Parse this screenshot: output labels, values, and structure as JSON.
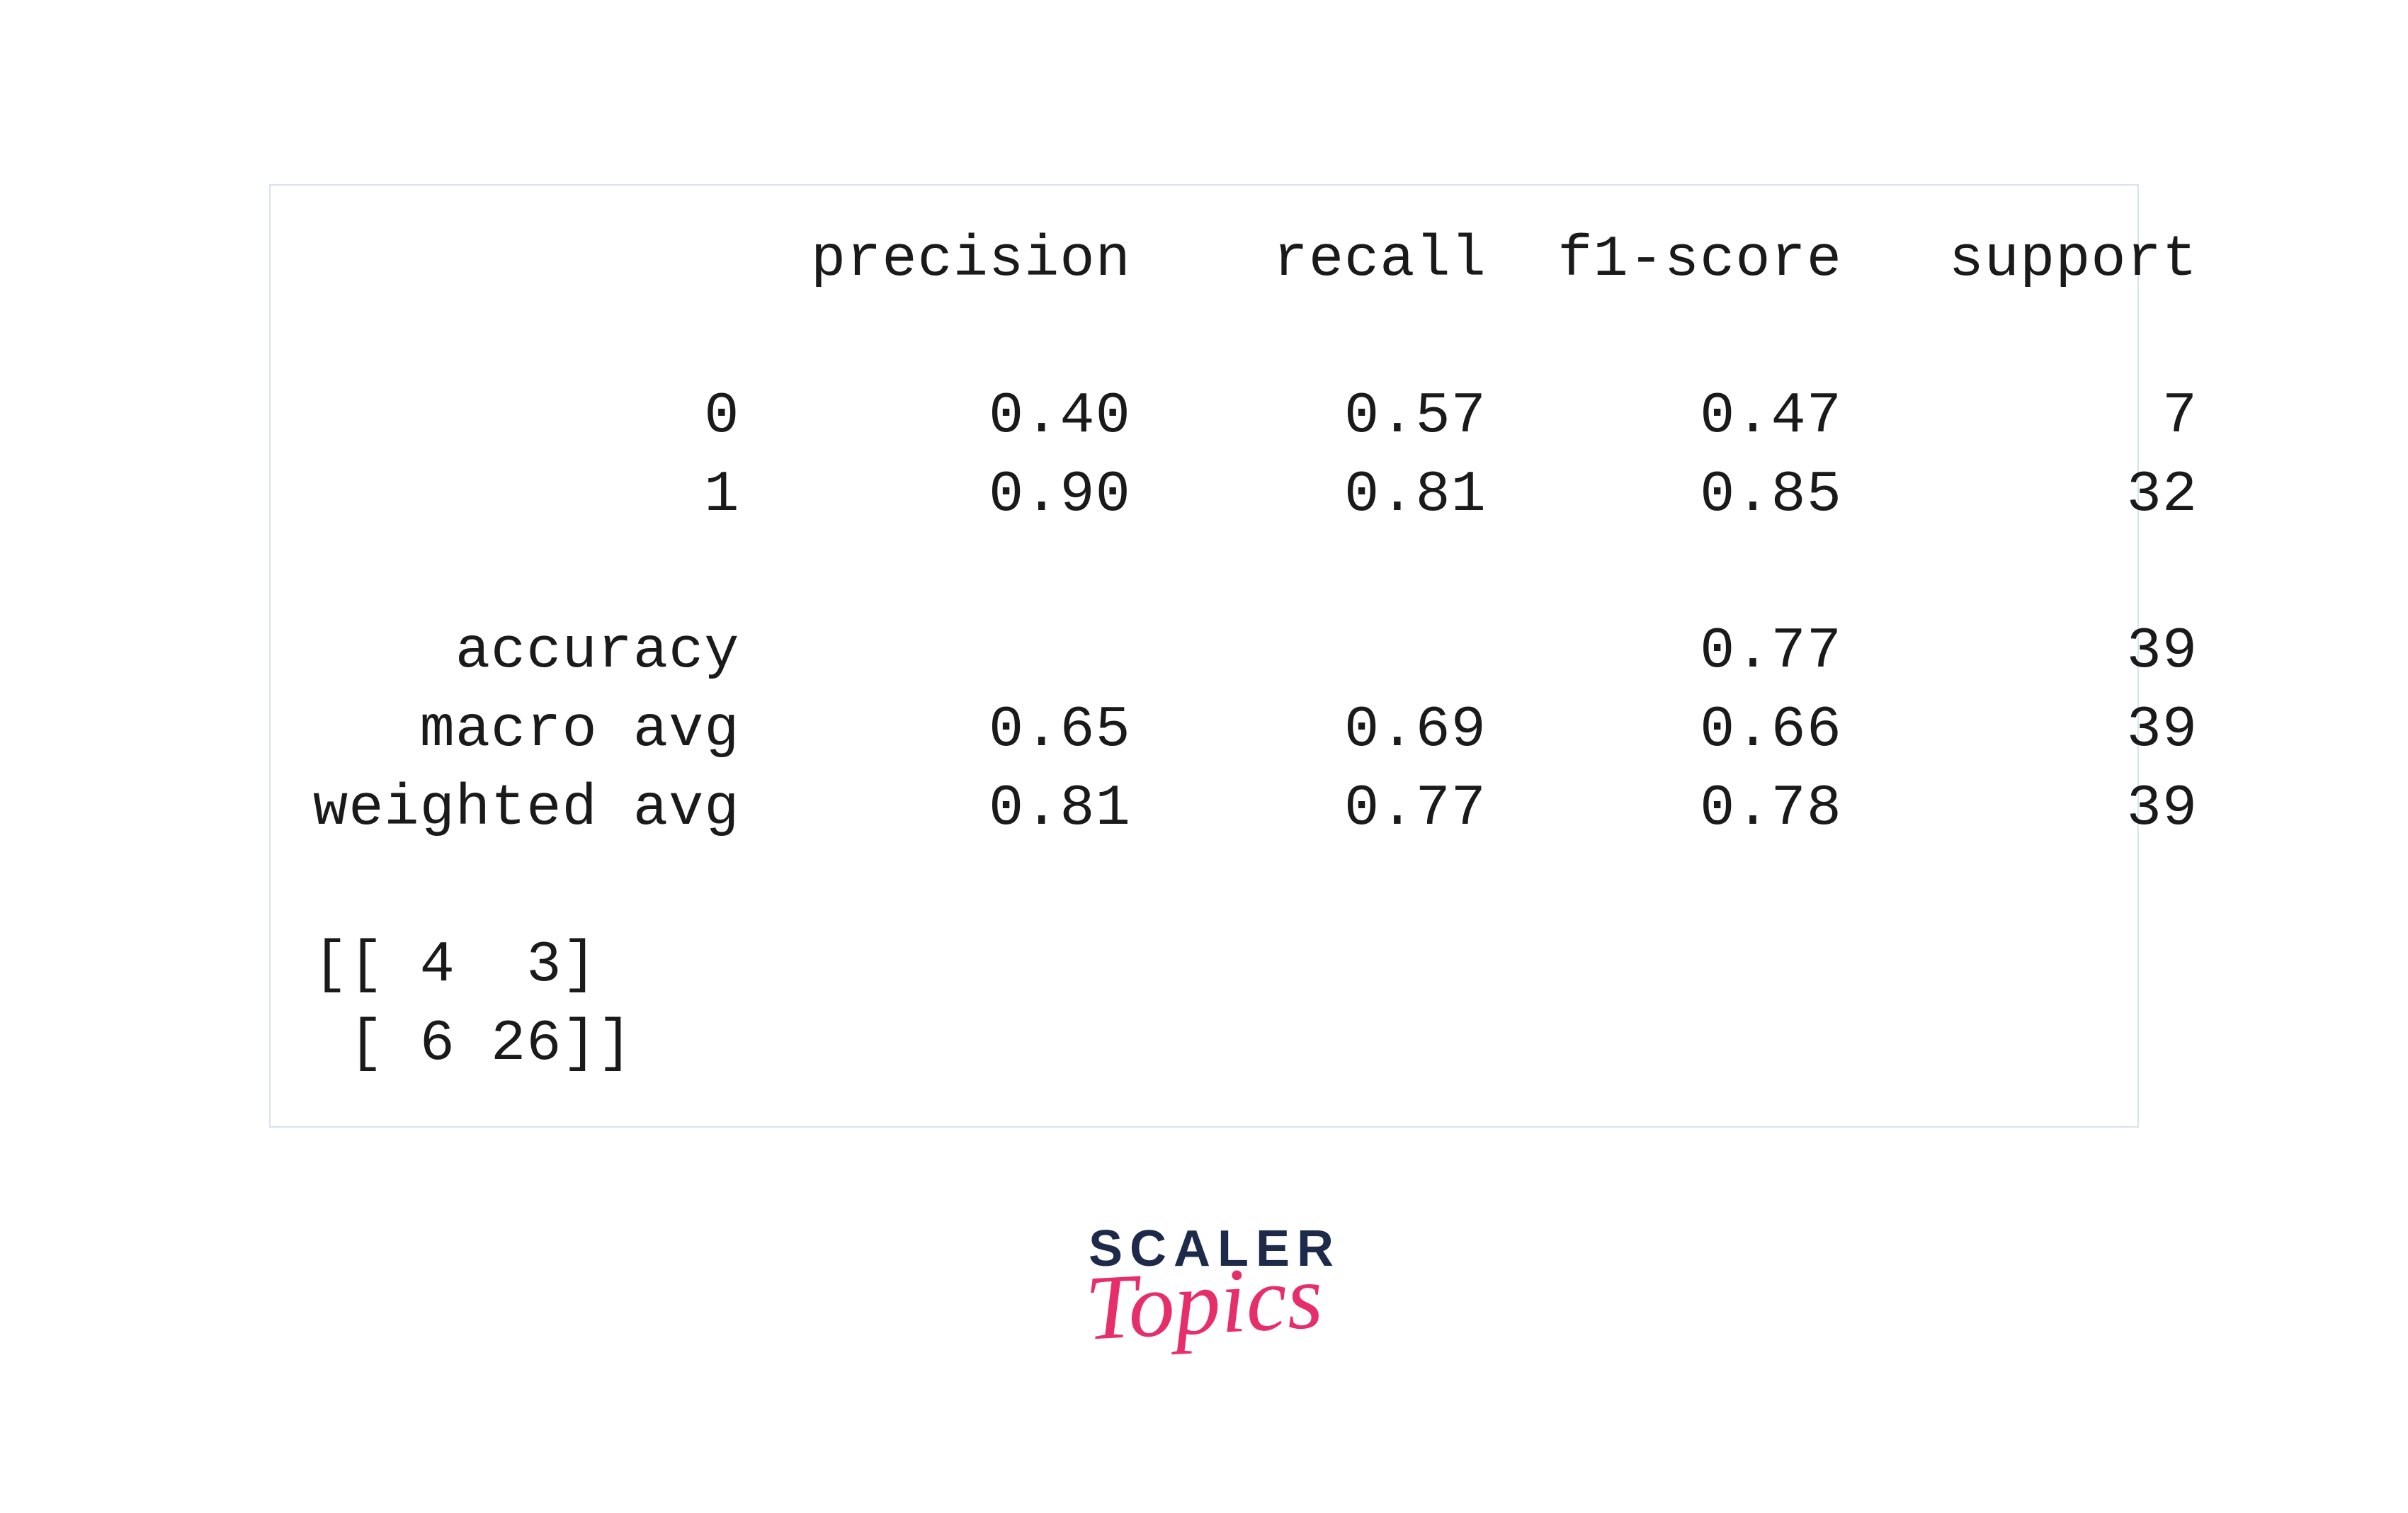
{
  "report": {
    "columns": [
      "precision",
      "recall",
      "f1-score",
      "support"
    ],
    "rows": [
      {
        "label": "0",
        "precision": "0.40",
        "recall": "0.57",
        "f1_score": "0.47",
        "support": "7"
      },
      {
        "label": "1",
        "precision": "0.90",
        "recall": "0.81",
        "f1_score": "0.85",
        "support": "32"
      }
    ],
    "accuracy": {
      "label": "accuracy",
      "f1_score": "0.77",
      "support": "39"
    },
    "macro_avg": {
      "label": "macro avg",
      "precision": "0.65",
      "recall": "0.69",
      "f1_score": "0.66",
      "support": "39"
    },
    "weighted_avg": {
      "label": "weighted avg",
      "precision": "0.81",
      "recall": "0.77",
      "f1_score": "0.78",
      "support": "39"
    }
  },
  "confusion_matrix": {
    "row1": "[[ 4  3]",
    "row2": " [ 6 26]]"
  },
  "logo": {
    "line1": "SCALER",
    "line2": "Topics"
  },
  "formatted": {
    "header": "              precision    recall  f1-score   support",
    "blank": "",
    "row0": "           0       0.40      0.57      0.47         7",
    "row1": "           1       0.90      0.81      0.85        32",
    "accuracy": "    accuracy                           0.77        39",
    "macro": "   macro avg       0.65      0.69      0.66        39",
    "weighted": "weighted avg       0.81      0.77      0.78        39"
  }
}
